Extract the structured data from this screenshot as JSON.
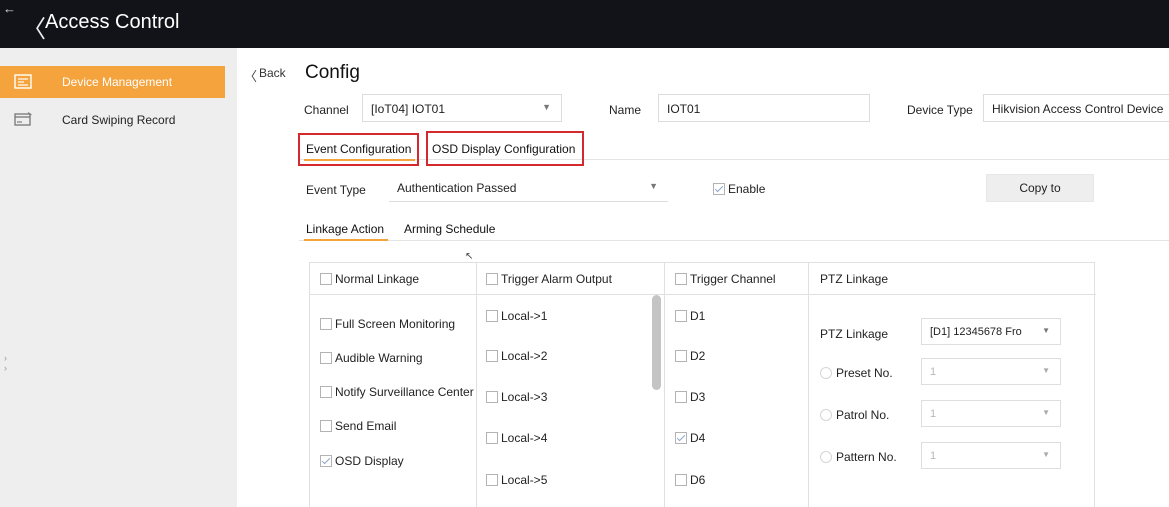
{
  "app": {
    "title": "Access Control",
    "back_glyph": "←",
    "chevron_glyph": "〈"
  },
  "sidebar": {
    "items": [
      {
        "label": "Device Management",
        "icon": "device-management-icon",
        "active": true
      },
      {
        "label": "Card Swiping Record",
        "icon": "card-swiping-icon",
        "active": false
      }
    ]
  },
  "page": {
    "back_label": "Back",
    "back_glyph": "〈",
    "title": "Config"
  },
  "form": {
    "channel_label": "Channel",
    "channel_value": "[IoT04] IOT01",
    "name_label": "Name",
    "name_value": "IOT01",
    "device_type_label": "Device Type",
    "device_type_value": "Hikvision Access Control Device"
  },
  "tabs": {
    "event_configuration": "Event Configuration",
    "osd_display_configuration": "OSD Display Configuration"
  },
  "event": {
    "event_type_label": "Event Type",
    "event_type_value": "Authentication Passed",
    "enable_label": "Enable",
    "enable_checked": true,
    "copy_to_label": "Copy to"
  },
  "subtabs": {
    "linkage_action": "Linkage Action",
    "arming_schedule": "Arming Schedule"
  },
  "linkage": {
    "headers": {
      "normal": "Normal Linkage",
      "alarm_output": "Trigger Alarm Output",
      "channel": "Trigger Channel",
      "ptz": "PTZ Linkage"
    },
    "normal_items": [
      {
        "label": "Full Screen Monitoring",
        "checked": false
      },
      {
        "label": "Audible Warning",
        "checked": false
      },
      {
        "label": "Notify Surveillance Center",
        "checked": false
      },
      {
        "label": "Send Email",
        "checked": false
      },
      {
        "label": "OSD Display",
        "checked": true
      }
    ],
    "alarm_outputs": [
      {
        "label": "Local->1",
        "checked": false
      },
      {
        "label": "Local->2",
        "checked": false
      },
      {
        "label": "Local->3",
        "checked": false
      },
      {
        "label": "Local->4",
        "checked": false
      },
      {
        "label": "Local->5",
        "checked": false
      }
    ],
    "channels": [
      {
        "label": "D1",
        "checked": false
      },
      {
        "label": "D2",
        "checked": false
      },
      {
        "label": "D3",
        "checked": false
      },
      {
        "label": "D4",
        "checked": true
      },
      {
        "label": "D6",
        "checked": false
      }
    ],
    "ptz": {
      "ptz_linkage_label": "PTZ Linkage",
      "ptz_linkage_value": "[D1] 12345678 Fro",
      "preset_label": "Preset No.",
      "preset_value": "1",
      "patrol_label": "Patrol No.",
      "patrol_value": "1",
      "pattern_label": "Pattern No.",
      "pattern_value": "1"
    }
  },
  "colors": {
    "topbar": "#121319",
    "accent": "#f5a33c",
    "highlight_box": "#d3292f",
    "sidebar_bg": "#eeeeee"
  }
}
